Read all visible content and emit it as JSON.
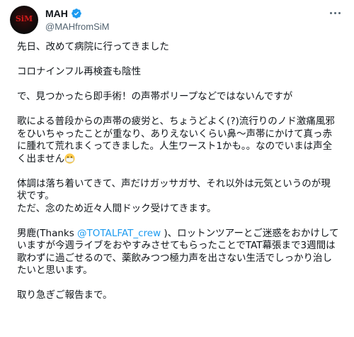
{
  "author": {
    "display_name": "MAH",
    "handle": "@MAHfromSiM",
    "avatar_text": "SiM",
    "avatar_icon": "band-logo-icon",
    "verified_icon": "verified-badge-icon",
    "verified_color": "#1d9bf0"
  },
  "menu": {
    "icon": "more-options-icon"
  },
  "colors": {
    "mention": "#1d9bf0",
    "text": "#0f1419",
    "secondary": "#536471"
  },
  "tweet": {
    "p1": "先日、改めて病院に行ってきました",
    "p2": "コロナインフル再検査も陰性",
    "p3": "で、見つかったら即手術！の声帯ポリープなどではないんですが",
    "p4_text": "歌による普段からの声帯の疲労と、ちょうどよく(?)流行りのノド激痛風邪をひいちゃったことが重なり、ありえないくらい鼻〜声帯にかけて真っ赤に腫れて荒れまくってきました。人生ワースト1かも。。なのでいまは声全く出ません",
    "p4_emoji": "mask-face-emoji-icon",
    "p5_line1": "体調は落ち着いてきて、声だけガッサガサ、それ以外は元気というのが現状です。",
    "p5_line2": "ただ、念のため近々人間ドック受けてきます。",
    "p6_before": "男鹿(Thanks ",
    "p6_mention": "@TOTALFAT_crew",
    "p6_after": " )、ロットンツアーとご迷惑をおかけしていますが今週ライブをおやすみさせてもらったことでTAT幕張まで3週間は歌わずに過ごせるので、薬飲みつつ極力声を出さない生活でしっかり治したいと思います。",
    "p7": "取り急ぎご報告まで。"
  }
}
